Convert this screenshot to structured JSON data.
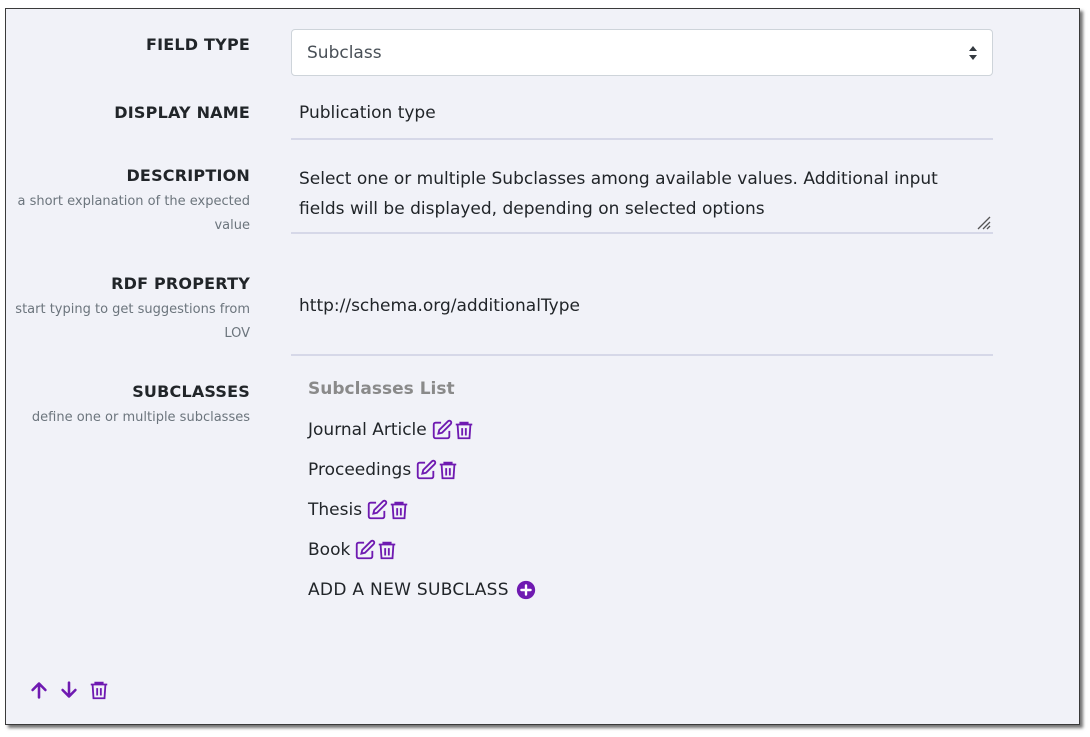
{
  "colors": {
    "accent": "#6f1ab1",
    "panel_bg": "#f1f2f8",
    "muted": "#6c757d"
  },
  "field_type": {
    "label": "FIELD TYPE",
    "value": "Subclass"
  },
  "display_name": {
    "label": "DISPLAY NAME",
    "value": "Publication type"
  },
  "description": {
    "label": "DESCRIPTION",
    "help": "a short explanation of the expected value",
    "value": "Select one or multiple Subclasses among available values. Additional input fields will be displayed, depending on selected options"
  },
  "rdf_property": {
    "label": "RDF PROPERTY",
    "help": "start typing to get suggestions from LOV",
    "value": "http://schema.org/additionalType"
  },
  "subclasses": {
    "label": "SUBCLASSES",
    "help": "define one or multiple subclasses",
    "list_title": "Subclasses List",
    "items": [
      {
        "label": "Journal Article",
        "edit_icon": "edit-icon",
        "delete_icon": "trash-icon"
      },
      {
        "label": "Proceedings",
        "edit_icon": "edit-icon",
        "delete_icon": "trash-icon"
      },
      {
        "label": "Thesis",
        "edit_icon": "edit-icon",
        "delete_icon": "trash-icon"
      },
      {
        "label": "Book",
        "edit_icon": "edit-icon",
        "delete_icon": "trash-icon"
      }
    ],
    "add_label": "ADD A NEW SUBCLASS",
    "add_icon": "plus-circle-icon"
  },
  "footer_icons": [
    "arrow-up-icon",
    "arrow-down-icon",
    "trash-icon"
  ]
}
